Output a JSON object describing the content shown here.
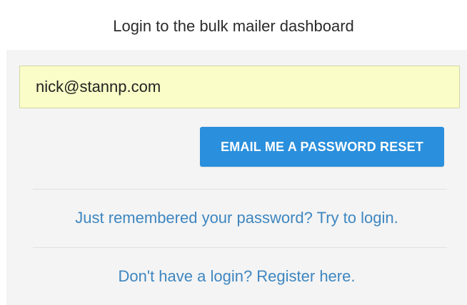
{
  "header": {
    "title": "Login to the bulk mailer dashboard"
  },
  "form": {
    "email_value": "nick@stannp.com",
    "reset_button_label": "EMAIL ME A PASSWORD RESET"
  },
  "links": {
    "login": "Just remembered your password? Try to login.",
    "register": "Don't have a login? Register here."
  },
  "colors": {
    "accent": "#2a8fdc",
    "link": "#3e86c0",
    "input_background": "#fafdc7",
    "panel_background": "#f4f4f4"
  }
}
